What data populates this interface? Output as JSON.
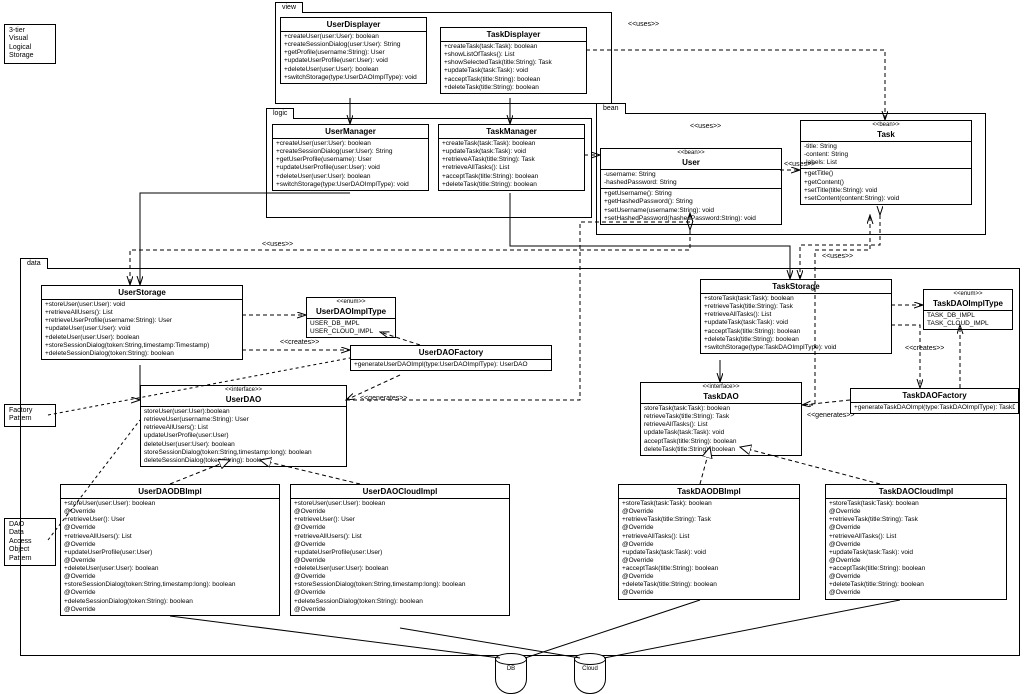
{
  "notes": {
    "visual": [
      "3-tier",
      "Visual",
      "Logical",
      "Storage"
    ],
    "factory": [
      "Factory",
      "Pattern"
    ],
    "dao": [
      "DAO",
      "Data",
      "Access",
      "Object",
      "Pattern"
    ]
  },
  "packages": {
    "view": "view",
    "logic": "logic",
    "bean": "bean",
    "data": "data"
  },
  "classes": {
    "UserDisplayer": {
      "name": "UserDisplayer",
      "ops": [
        "+createUser(user:User): boolean",
        "+createSessionDialog(user:User): String",
        "+getProfile(username:String): User",
        "+updateUserProfile(user:User): void",
        "+deleteUser(user:User): boolean",
        "+switchStorage(type:UserDAOImplType): void"
      ]
    },
    "TaskDisplayer": {
      "name": "TaskDisplayer",
      "ops": [
        "+createTask(task:Task): boolean",
        "+showListOfTasks(): List<Task>",
        "+showSelectedTask(title:String): Task",
        "+updateTask(task:Task): void",
        "+acceptTask(title:String): boolean",
        "+deleteTask(title:String): boolean"
      ]
    },
    "UserManager": {
      "name": "UserManager",
      "ops": [
        "+createUser(user:User): boolean",
        "+createSessionDialog(user:User): String",
        "+getUserProfile(username): User",
        "+updateUserProfile(user:User): void",
        "+deleteUser(user:User): boolean",
        "+switchStorage(type:UserDAOImplType): void"
      ]
    },
    "TaskManager": {
      "name": "TaskManager",
      "ops": [
        "+createTask(task:Task): boolean",
        "+updateTask(task:Task): void",
        "+retrieveATask(title:String): Task",
        "+retrieveAllTasks(): List<Task>",
        "+acceptTask(title:String): boolean",
        "+deleteTask(title:String): boolean"
      ]
    },
    "User": {
      "name": "User",
      "stereo": "<<bean>>",
      "attrs": [
        "-username: String",
        "-hashedPassword: String"
      ],
      "ops": [
        "+getUsername(): String",
        "+getHashedPassword(): String",
        "+setUsername(username:String): void",
        "+setHashedPassword(hashedPassword:String): void"
      ]
    },
    "Task": {
      "name": "Task",
      "stereo": "<<bean>>",
      "attrs": [
        "-title: String",
        "-content: String",
        "-labels: List<String>"
      ],
      "ops": [
        "+getTitle()",
        "+getContent()",
        "+setTitle(title:String): void",
        "+setContent(content:String): void"
      ]
    },
    "UserStorage": {
      "name": "UserStorage",
      "ops": [
        "+storeUser(user:User): void",
        "+retrieveAllUsers(): List<User>",
        "+retrieveUserProfile(username:String): User",
        "+updateUser(user:User): void",
        "+deleteUser(user:User): boolean",
        "+storeSessionDialog(token:String,timestamp:Timestamp)",
        "+deleteSessionDialog(token:String): boolean"
      ]
    },
    "UserDAOImplType": {
      "name": "UserDAOImplType",
      "stereo": "<<enum>>",
      "attrs": [
        "USER_DB_IMPL",
        "USER_CLOUD_IMPL"
      ]
    },
    "UserDAOFactory": {
      "name": "UserDAOFactory",
      "ops": [
        "+generateUserDAOImpl(type:UserDAOImplType): UserDAO"
      ]
    },
    "UserDAO": {
      "name": "UserDAO",
      "stereo": "<<interface>>",
      "ops": [
        "storeUser(user:User):boolean",
        "retrieveUser(username:String): User",
        "retrieveAllUsers(): List<User>",
        "updateUserProfile(user:User)",
        "deleteUser(user:User): boolean",
        "storeSessionDialog(token:String,timestamp:long): boolean",
        "deleteSessionDialog(token:String): boolean"
      ]
    },
    "UserDAODBImpl": {
      "name": "UserDAODBImpl",
      "ops": [
        "+storeUser(user:User): boolean",
        "@Override",
        "+retrieveUser(): User",
        "@Override",
        "+retrieveAllUsers(): List<User>",
        "@Override",
        "+updateUserProfile(user:User)",
        "@Override",
        "+deleteUser(user:User): boolean",
        "@Override",
        "+storeSessionDialog(token:String,timestamp:long): boolean",
        "@Override",
        "+deleteSessionDialog(token:String): boolean",
        "@Override"
      ]
    },
    "UserDAOCloudImpl": {
      "name": "UserDAOCloudImpl",
      "ops": [
        "+storeUser(user:User): boolean",
        "@Override",
        "+retrieveUser(): User",
        "@Override",
        "+retrieveAllUsers(): List<User>",
        "@Override",
        "+updateUserProfile(user:User)",
        "@Override",
        "+deleteUser(user:User): boolean",
        "@Override",
        "+storeSessionDialog(token:String,timestamp:long): boolean",
        "@Override",
        "+deleteSessionDialog(token:String): boolean",
        "@Override"
      ]
    },
    "TaskStorage": {
      "name": "TaskStorage",
      "ops": [
        "+storeTask(task:Task): boolean",
        "+retrieveTask(title:String): Task",
        "+retrieveAllTasks(): List<Task>",
        "+updateTask(task:Task): void",
        "+acceptTask(title:String): boolean",
        "+deleteTask(title:String): boolean",
        "+switchStorage(type:TaskDAOImplType): void"
      ]
    },
    "TaskDAOImplType": {
      "name": "TaskDAOImplType",
      "stereo": "<<enum>>",
      "attrs": [
        "TASK_DB_IMPL",
        "TASK_CLOUD_IMPL"
      ]
    },
    "TaskDAOFactory": {
      "name": "TaskDAOFactory",
      "ops": [
        "+generateTaskDAOImpl(type:TaskDAOImplType): TaskDAO"
      ]
    },
    "TaskDAO": {
      "name": "TaskDAO",
      "stereo": "<<interface>>",
      "ops": [
        "storeTask(task:Task): boolean",
        "retrieveTask(title:String): Task",
        "retrieveAllTasks(): List<Task>",
        "updateTask(task:Task): void",
        "acceptTask(title:String): boolean",
        "deleteTask(title:String): boolean"
      ]
    },
    "TaskDAODBImpl": {
      "name": "TaskDAODBImpl",
      "ops": [
        "+storeTask(task:Task): boolean",
        "@Override",
        "+retrieveTask(title:String): Task",
        "@Override",
        "+retrieveAllTasks(): List<Task>",
        "@Override",
        "+updateTask(task:Task): void",
        "@Override",
        "+acceptTask(title:String): boolean",
        "@Override",
        "+deleteTask(title:String): boolean",
        "@Override"
      ]
    },
    "TaskDAOCloudImpl": {
      "name": "TaskDAOCloudImpl",
      "ops": [
        "+storeTask(task:Task): boolean",
        "@Override",
        "+retrieveTask(title:String): Task",
        "@Override",
        "+retrieveAllTasks(): List<Task>",
        "@Override",
        "+updateTask(task:Task): void",
        "@Override",
        "+acceptTask(title:String): boolean",
        "@Override",
        "+deleteTask(title:String): boolean",
        "@Override"
      ]
    }
  },
  "rels": {
    "uses": "<<uses>>",
    "creates": "<<creates>>",
    "generates": "<<generates>>"
  },
  "dbs": {
    "db": "DB",
    "cloud": "Cloud"
  }
}
